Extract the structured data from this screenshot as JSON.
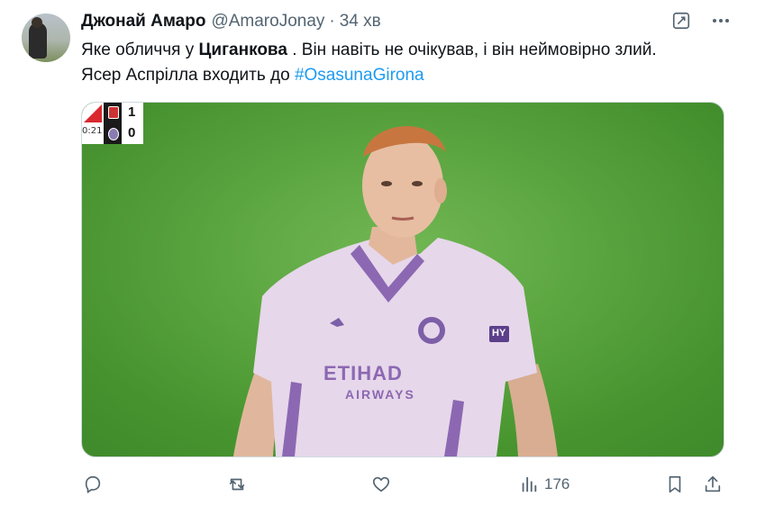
{
  "author": {
    "display_name": "Джонай Амаро",
    "handle": "@AmaroJonay",
    "separator": "·",
    "time": "34 хв"
  },
  "tweet": {
    "text_part1": "Яке обличчя у ",
    "mention_bold": "Циганкова",
    "text_part2": " . Він навіть не очікував, і він неймовірно злий.",
    "text_line2": "Ясер Аспрілла входить до ",
    "hashtag": "#OsasunaGirona"
  },
  "media": {
    "scoreboard": {
      "time": "0:21",
      "score_home": "1",
      "score_away": "0"
    },
    "shirt_sponsor_line1": "ETIHAD",
    "shirt_sponsor_line2": "AIRWAYS",
    "sleeve_text": "HY"
  },
  "actions": {
    "views_count": "176"
  },
  "icons": [
    "grok-icon",
    "more-icon",
    "reply-icon",
    "retweet-icon",
    "like-icon",
    "views-icon",
    "bookmark-icon",
    "share-icon"
  ],
  "colors": {
    "hashtag": "#1d9bf0",
    "muted": "#536471",
    "text": "#0f1419"
  }
}
